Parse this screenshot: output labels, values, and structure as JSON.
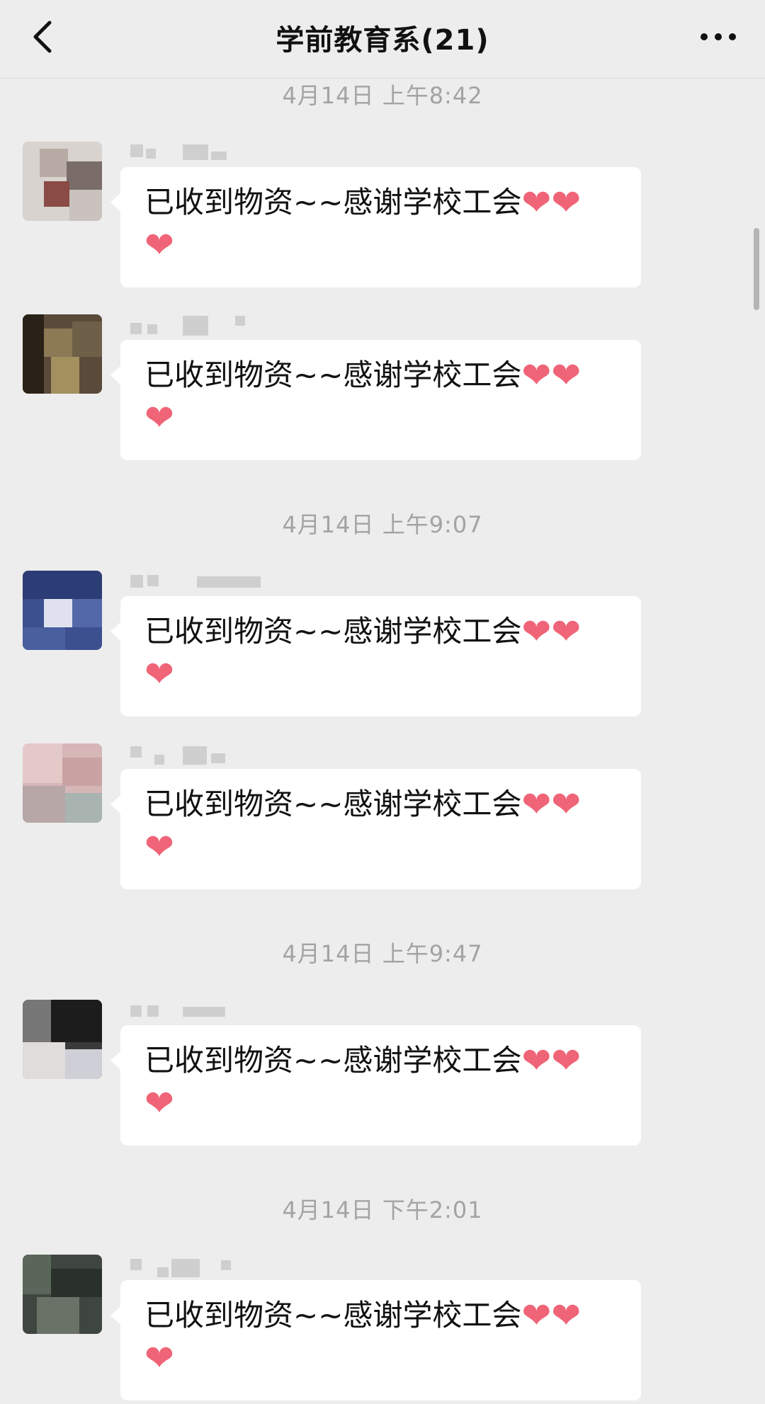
{
  "nav": {
    "title": "学前教育系(21)",
    "back_icon": "chevron-left-icon",
    "more_icon": "more-dots-icon"
  },
  "colors": {
    "background": "#ededed",
    "bubble": "#ffffff",
    "heart": "#f06478",
    "timestamp": "#a3a3a3"
  },
  "timestamps": [
    "4月14日 上午8:42",
    "4月14日 上午9:07",
    "4月14日 上午9:47",
    "4月14日 下午2:01"
  ],
  "messages": [
    {
      "text": "已收到物资~~感谢学校工会",
      "hearts": [
        "❤",
        "❤",
        "❤"
      ]
    },
    {
      "text": "已收到物资~~感谢学校工会",
      "hearts": [
        "❤",
        "❤",
        "❤"
      ]
    },
    {
      "text": "已收到物资~~感谢学校工会",
      "hearts": [
        "❤",
        "❤",
        "❤"
      ]
    },
    {
      "text": "已收到物资~~感谢学校工会",
      "hearts": [
        "❤",
        "❤",
        "❤"
      ]
    },
    {
      "text": "已收到物资~~感谢学校工会",
      "hearts": [
        "❤",
        "❤",
        "❤"
      ]
    },
    {
      "text": "已收到物资~~感谢学校工会",
      "hearts": [
        "❤",
        "❤",
        "❤"
      ]
    }
  ]
}
